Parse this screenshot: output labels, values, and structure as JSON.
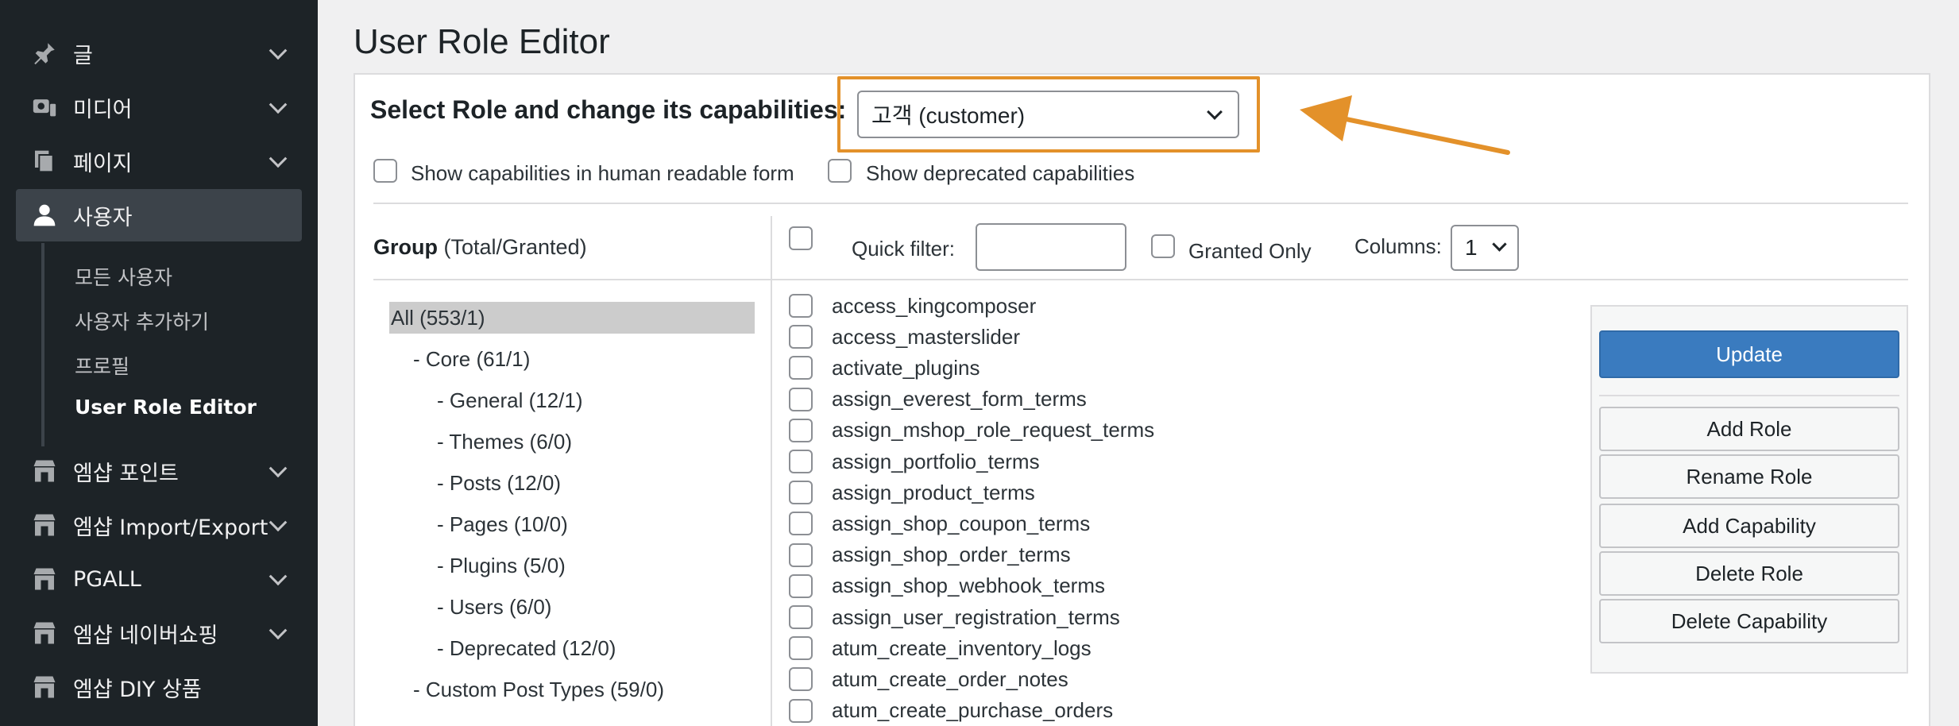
{
  "sidebar": {
    "items": [
      {
        "label": "글",
        "icon": "pin-icon"
      },
      {
        "label": "미디어",
        "icon": "media-icon"
      },
      {
        "label": "페이지",
        "icon": "pages-icon"
      },
      {
        "label": "사용자",
        "icon": "user-icon"
      },
      {
        "label": "엠샵 포인트",
        "icon": "store-icon"
      },
      {
        "label": "엠샵 Import/Export",
        "icon": "store-icon"
      },
      {
        "label": "PGALL",
        "icon": "store-icon"
      },
      {
        "label": "엠샵 네이버쇼핑",
        "icon": "store-icon"
      },
      {
        "label": "엠샵 DIY 상품",
        "icon": "store-icon"
      }
    ],
    "submenu": [
      "모든 사용자",
      "사용자 추가하기",
      "프로필",
      "User Role Editor"
    ]
  },
  "page": {
    "title": "User Role Editor"
  },
  "role": {
    "title": "Select Role and change its capabilities:",
    "selected": "고객 (customer)"
  },
  "options": {
    "human_readable": "Show capabilities in human readable form",
    "deprecated": "Show deprecated capabilities"
  },
  "groups": {
    "header_bold": "Group",
    "header_rest": " (Total/Granted)",
    "items": [
      "All (553/1)",
      "- Core (61/1)",
      "- General (12/1)",
      "- Themes (6/0)",
      "- Posts (12/0)",
      "- Pages (10/0)",
      "- Plugins (5/0)",
      "- Users (6/0)",
      "- Deprecated (12/0)",
      "- Custom Post Types (59/0)"
    ]
  },
  "toolbar": {
    "quick_filter": "Quick filter:",
    "granted_only": "Granted Only",
    "columns_label": "Columns:",
    "columns_value": "1"
  },
  "capabilities": [
    "access_kingcomposer",
    "access_masterslider",
    "activate_plugins",
    "assign_everest_form_terms",
    "assign_mshop_role_request_terms",
    "assign_portfolio_terms",
    "assign_product_terms",
    "assign_shop_coupon_terms",
    "assign_shop_order_terms",
    "assign_shop_webhook_terms",
    "assign_user_registration_terms",
    "atum_create_inventory_logs",
    "atum_create_order_notes",
    "atum_create_purchase_orders"
  ],
  "actions": {
    "update": "Update",
    "add_role": "Add Role",
    "rename_role": "Rename Role",
    "add_capability": "Add Capability",
    "delete_role": "Delete Role",
    "delete_capability": "Delete Capability"
  },
  "colors": {
    "highlight": "#e3912a",
    "primary": "#3a7bbf",
    "sidebar": "#1d2327"
  }
}
